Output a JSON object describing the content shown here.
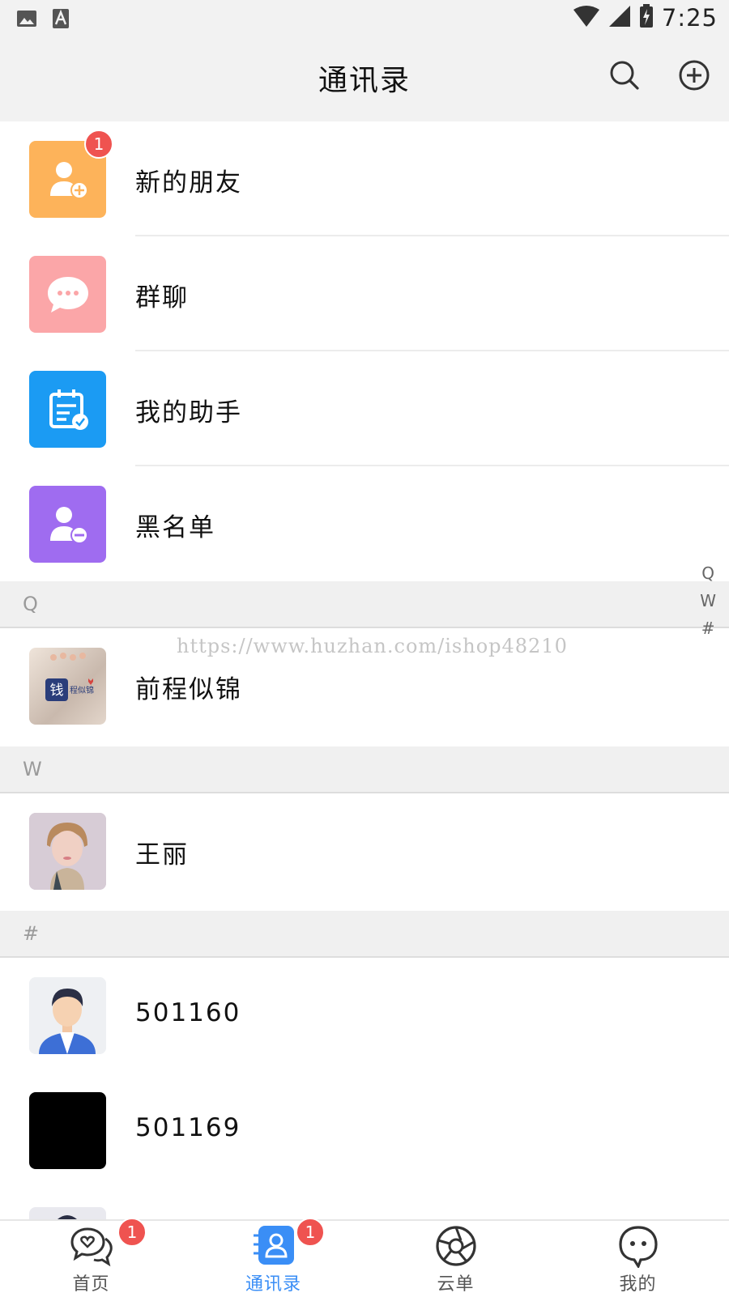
{
  "status_bar": {
    "time": "7:25"
  },
  "header": {
    "title": "通讯录",
    "search_icon": "search-icon",
    "add_icon": "plus-circle-icon"
  },
  "menu": [
    {
      "label": "新的朋友",
      "icon": "add-user-icon",
      "color": "#fdb35a",
      "badge": "1"
    },
    {
      "label": "群聊",
      "icon": "chat-bubble-icon",
      "color": "#fba6a8"
    },
    {
      "label": "我的助手",
      "icon": "calendar-check-icon",
      "color": "#1b9bf3"
    },
    {
      "label": "黑名单",
      "icon": "remove-user-icon",
      "color": "#9f6cf0"
    }
  ],
  "sections": [
    {
      "letter": "Q",
      "contacts": [
        {
          "name": "前程似锦"
        }
      ]
    },
    {
      "letter": "W",
      "contacts": [
        {
          "name": "王丽"
        }
      ]
    },
    {
      "letter": "#",
      "contacts": [
        {
          "name": "501160"
        },
        {
          "name": "501169"
        }
      ]
    }
  ],
  "avatar_logo": {
    "big": "钱",
    "small": "程似锦"
  },
  "index_bar": [
    "Q",
    "W",
    "#"
  ],
  "watermark": "https://www.huzhan.com/ishop48210",
  "tabs": [
    {
      "label": "首页",
      "icon": "heart-chat-icon",
      "badge": "1",
      "active": false
    },
    {
      "label": "通讯录",
      "icon": "contacts-icon",
      "badge": "1",
      "active": true
    },
    {
      "label": "云单",
      "icon": "aperture-icon",
      "active": false
    },
    {
      "label": "我的",
      "icon": "ghost-chat-icon",
      "active": false
    }
  ],
  "colors": {
    "accent": "#3a8ef6",
    "badge": "#ef5350"
  }
}
